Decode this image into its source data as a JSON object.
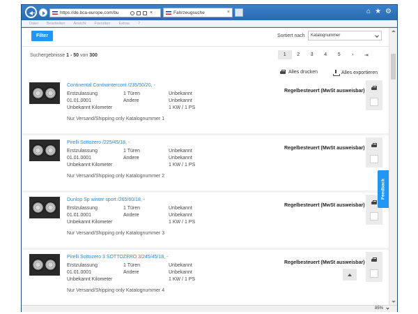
{
  "browser": {
    "url": "https://de.bca-europe.com/bu",
    "tab_title": "Fahrzeugsuche",
    "tab_close": "×",
    "address_close": "×",
    "window_icons": [
      "⌂",
      "★",
      "⚙"
    ]
  },
  "menu": [
    "Datei",
    "Bearbeiten",
    "Ansicht",
    "Favoriten",
    "Extras",
    "?"
  ],
  "toolbar": {
    "filter_label": "Filter",
    "sort_label": "Sortiert nach",
    "sort_value": "Katalognummer"
  },
  "results": {
    "prefix": "Suchergebnisse",
    "range": "1 - 50",
    "mid": "von",
    "total": "300"
  },
  "pagination": {
    "pages": [
      "1",
      "2",
      "3",
      "4",
      "5",
      "›",
      "⇥"
    ],
    "active_index": 0
  },
  "actions": {
    "print_all": "Alles drucken",
    "export_all": "Alles exportieren"
  },
  "listings": [
    {
      "title": "Continental Contiwintercont /235/50/20, -",
      "col1": [
        "Erstzulassung",
        "01.01.0001",
        "Unbekannt Kilometer"
      ],
      "col2": [
        "1 Türen",
        "Andere"
      ],
      "col3": [
        "Unbekannt",
        "Unbekannt",
        "1 KW / 1 PS"
      ],
      "shipping": "Nur Versand/Shipping only Katalognummer 1",
      "tax": "Regelbesteuert (MwSt ausweisbar)"
    },
    {
      "title": "Pirelli Sottozero /225/45/18, -",
      "col1": [
        "Erstzulassung",
        "01.01.0001",
        "Unbekannt Kilometer"
      ],
      "col2": [
        "1 Türen",
        "Andere"
      ],
      "col3": [
        "Unbekannt",
        "Unbekannt",
        "1 KW / 1 PS"
      ],
      "shipping": "Nur Versand/Shipping only Katalognummer 2",
      "tax": "Regelbesteuert (MwSt ausweisbar)"
    },
    {
      "title": "Dunlop Sp winter sport /265/60/18, -",
      "col1": [
        "Erstzulassung",
        "01.01.0001",
        "Unbekannt Kilometer"
      ],
      "col2": [
        "1 Türen",
        "Andere"
      ],
      "col3": [
        "Unbekannt",
        "Unbekannt",
        "1 KW / 1 PS"
      ],
      "shipping": "Nur Versand/Shipping only Katalognummer 3",
      "tax": "Regelbesteuert (MwSt ausweisbar)"
    },
    {
      "title": "Pirelli Sottozero 3 SOTTOZERO 3/245/45/18, -",
      "col1": [
        "Erstzulassung",
        "01.01.0001",
        "Unbekannt Kilometer"
      ],
      "col2": [
        "1 Türen",
        "Andere"
      ],
      "col3": [
        "Unbekannt",
        "Unbekannt",
        "1 KW / 1 PS"
      ],
      "shipping": "Nur Versand/Shipping only Katalognummer 4",
      "tax": "Regelbesteuert (MwSt ausweisbar)"
    }
  ],
  "feedback_label": "Feedback",
  "status": {
    "zoom": "85%"
  },
  "colors": {
    "accent": "#2196f3",
    "link": "#1e88e5",
    "browser_chrome": "#2f6fb3"
  }
}
